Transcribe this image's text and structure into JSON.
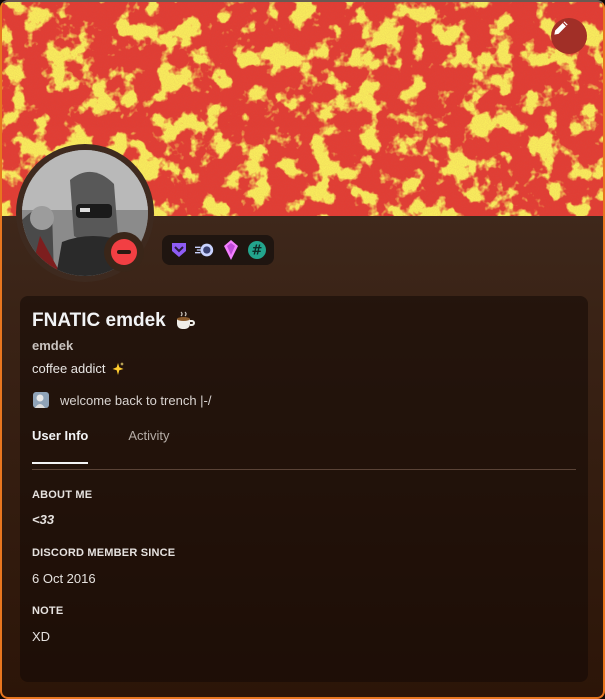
{
  "profile": {
    "display_name": "FNATIC emdek",
    "display_name_emoji": "coffee-emoji",
    "username": "emdek",
    "bio": "coffee addict",
    "bio_emoji": "sparkles-emoji",
    "custom_status": "welcome back to trench |-/",
    "status": "do-not-disturb"
  },
  "badges": [
    "hypesquad-balance-badge",
    "nitro-boost-badge",
    "server-boost-gem-badge",
    "originally-known-as-badge"
  ],
  "tabs": [
    {
      "label": "User Info",
      "active": true
    },
    {
      "label": "Activity",
      "active": false
    }
  ],
  "sections": {
    "about_me": {
      "heading": "ABOUT ME",
      "value": "<33"
    },
    "member_since": {
      "heading": "DISCORD MEMBER SINCE",
      "value": "6 Oct 2016"
    },
    "note": {
      "heading": "NOTE",
      "value": "XD"
    }
  },
  "colors": {
    "banner_red": "#e23d33",
    "banner_yellow": "#f5e21c",
    "accent_border": "#e8761f",
    "dnd_red": "#f23f43"
  }
}
